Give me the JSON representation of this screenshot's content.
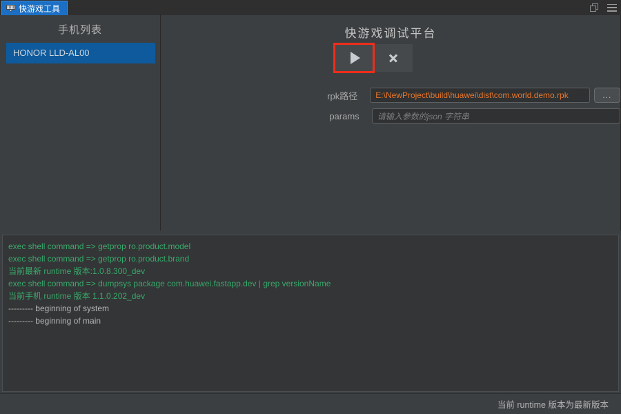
{
  "window": {
    "tab_label": "快游戏工具",
    "tab_icon": "app-icon",
    "restore_icon": "restore-window-icon",
    "menu_icon": "hamburger-menu-icon",
    "accent_blue": "#1b6fc4",
    "selection_red": "#ee2d1a",
    "value_orange": "#e8762c",
    "log_green": "#39a96b"
  },
  "device_panel": {
    "title": "手机列表",
    "devices": [
      {
        "name": "HONOR LLD-AL00",
        "selected": true
      }
    ]
  },
  "main_panel": {
    "title": "快游戏调试平台",
    "buttons": [
      {
        "name": "run-button",
        "icon": "play-icon",
        "highlighted": true
      },
      {
        "name": "stop-button",
        "icon": "close-x-icon",
        "highlighted": false
      }
    ],
    "form": {
      "rpk_path": {
        "label": "rpk路径",
        "value": "E:\\NewProject\\build\\huawei\\dist\\com.world.demo.rpk",
        "placeholder": "",
        "browse_label": "..."
      },
      "params": {
        "label": "params",
        "value": "",
        "placeholder": "请输入参数的json 字符串"
      }
    }
  },
  "log_panel": {
    "lines": [
      {
        "text": "exec shell command => getprop ro.product.model",
        "style": "green"
      },
      {
        "text": "exec shell command => getprop ro.product.brand",
        "style": "green"
      },
      {
        "text": "当前最新 runtime 版本:1.0.8.300_dev",
        "style": "green"
      },
      {
        "text": "exec shell command => dumpsys package com.huawei.fastapp.dev | grep versionName",
        "style": "green"
      },
      {
        "text": "当前手机 runtime 版本 1.1.0.202_dev",
        "style": "green"
      },
      {
        "text": "--------- beginning of system",
        "style": "grey"
      },
      {
        "text": "--------- beginning of main",
        "style": "grey"
      }
    ]
  },
  "status_bar": {
    "message": "当前 runtime 版本为最新版本"
  }
}
